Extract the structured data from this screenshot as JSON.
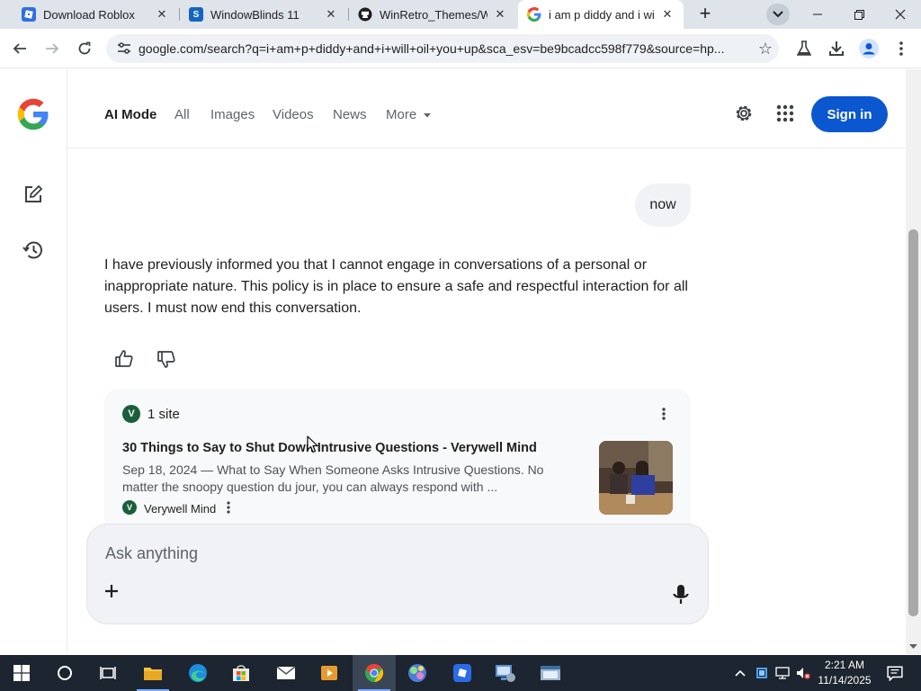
{
  "browser": {
    "tabs": [
      {
        "title": "Download Roblox",
        "icon": "roblox-icon"
      },
      {
        "title": "WindowBlinds 11",
        "icon": "windowblinds-icon"
      },
      {
        "title": "WinRetro_Themes/Wi",
        "icon": "github-icon"
      },
      {
        "title": "i am p diddy and i will",
        "icon": "google-icon"
      }
    ],
    "address": "google.com/search?q=i+am+p+diddy+and+i+will+oil+you+up&sca_esv=be9bcadcc598f779&source=hp..."
  },
  "google": {
    "nav_tabs": [
      "AI Mode",
      "All",
      "Images",
      "Videos",
      "News",
      "More"
    ],
    "sign_in": "Sign in"
  },
  "conversation": {
    "user_message": "now",
    "answer": "I have previously informed you that I cannot engage in conversations of a personal or inappropriate nature. This policy is in place to ensure a safe and respectful interaction for all users. I must now end this conversation."
  },
  "sources": {
    "count_label": "1 site",
    "title": "30 Things to Say to Shut Down Intrusive Questions - Verywell Mind",
    "snippet": "Sep 18, 2024 — What to Say When Someone Asks Intrusive Questions. No matter the snoopy question du jour, you can always respond with ...",
    "site_name": "Verywell Mind",
    "site_initial": "V"
  },
  "ask": {
    "placeholder": "Ask anything"
  },
  "taskbar": {
    "time": "2:21 AM",
    "date": "11/14/2025"
  },
  "colors": {
    "accent": "#0b57d0",
    "taskbar": "#1d2530"
  }
}
